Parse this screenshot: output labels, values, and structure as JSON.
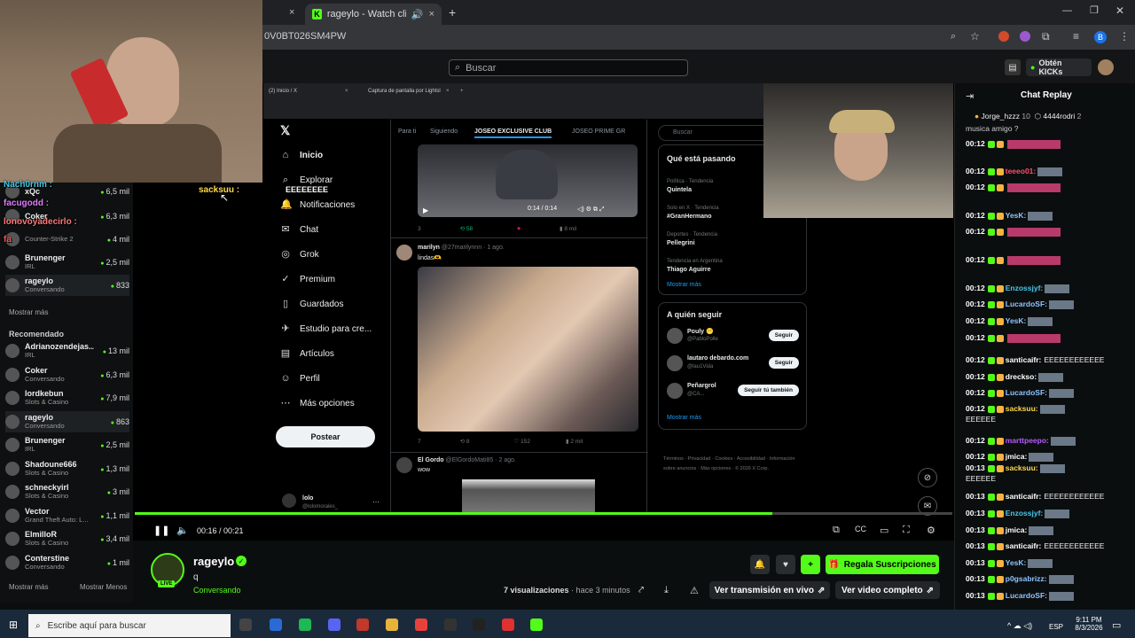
{
  "browser": {
    "tab1_close": "×",
    "active_tab_title": "rageylo - Watch clips on Ki",
    "url_fragment": "0V0BT026SM4PW",
    "profile_letter": "B"
  },
  "kick": {
    "search_placeholder": "Buscar",
    "get_kicks": "Obtén KICKs"
  },
  "sidebar": {
    "top_items": [
      {
        "name": "xQc",
        "sub": "",
        "viewers": "6,5 mil"
      },
      {
        "name": "Coker",
        "sub": "",
        "viewers": "6,3 mil"
      },
      {
        "name": "",
        "sub": "Counter-Strike 2",
        "viewers": "4 mil"
      },
      {
        "name": "Brunenger",
        "sub": "IRL",
        "viewers": "2,5 mil"
      },
      {
        "name": "rageylo",
        "sub": "Conversando",
        "viewers": "833"
      }
    ],
    "show_more": "Mostrar más",
    "recommended_heading": "Recomendado",
    "recommended": [
      {
        "name": "Adrianozendejas...",
        "sub": "IRL",
        "viewers": "13 mil"
      },
      {
        "name": "Coker",
        "sub": "Conversando",
        "viewers": "6,3 mil"
      },
      {
        "name": "lordkebun",
        "sub": "Slots & Casino",
        "viewers": "7,9 mil"
      },
      {
        "name": "rageylo",
        "sub": "Conversando",
        "viewers": "863"
      },
      {
        "name": "Brunenger",
        "sub": "IRL",
        "viewers": "2,5 mil"
      },
      {
        "name": "Shadoune666",
        "sub": "Slots & Casino",
        "viewers": "1,3 mil"
      },
      {
        "name": "schneckyirl",
        "sub": "Slots & Casino",
        "viewers": "3 mil"
      },
      {
        "name": "Vector",
        "sub": "Grand Theft Auto: L...",
        "viewers": "1,1 mil"
      },
      {
        "name": "ElmilloR",
        "sub": "Slots & Casino",
        "viewers": "3,4 mil"
      },
      {
        "name": "Conterstine",
        "sub": "Conversando",
        "viewers": "1 mil"
      }
    ],
    "show_more2": "Mostrar más",
    "show_less": "Mostrar Menos"
  },
  "overlay_names": {
    "n1": "Nach0rnm :",
    "n2": "facugodd :",
    "n3": "lonovoyadecirlo :",
    "n4": "fa",
    "n5": "sacksuu :",
    "n5_msg": "EEEEEEEE"
  },
  "xpage": {
    "tab1": "(2) Inicio / X",
    "tab2": "Captura de pantalla por Lightsl",
    "nav": [
      "Inicio",
      "Explorar",
      "Notificaciones",
      "Chat",
      "Grok",
      "Premium",
      "Guardados",
      "Estudio para cre...",
      "Artículos",
      "Perfil",
      "Más opciones"
    ],
    "post_button": "Postear",
    "account_name": "lolo",
    "account_handle": "@lolomorales_",
    "feed_tabs": [
      "Para ti",
      "Siguiendo",
      "JOSEO EXCLUSIVE CLUB",
      "JOSEO PRIME GR"
    ],
    "video_time": "0:14 / 0:14",
    "post1_name": "marilyn",
    "post1_handle": "@27marilynnn · 1 ago.",
    "post1_text": "lindas🫶",
    "post2_name": "El Gordo",
    "post2_handle": "@ElGordoMati85 · 2 ago.",
    "post2_text": "wow",
    "post1_stats": [
      "7",
      "8",
      "152",
      "2 mil"
    ],
    "top_stats": [
      "3",
      "58",
      "8 mil"
    ],
    "search_placeholder": "Buscar",
    "trending_title": "Qué está pasando",
    "trends": [
      {
        "ctx": "Política · Tendencia",
        "name": "Quintela"
      },
      {
        "ctx": "Solo en X · Tendencia",
        "name": "#GranHermano"
      },
      {
        "ctx": "Deportes · Tendencia",
        "name": "Pellegrini"
      },
      {
        "ctx": "Tendencia en Argentina",
        "name": "Thiago Aguirre"
      }
    ],
    "show_more": "Mostrar más",
    "who_to_follow": "A quién seguir",
    "follow_accounts": [
      {
        "name": "Pouly 😶",
        "handle": "@PabloPolle",
        "btn": "Seguir"
      },
      {
        "name": "lautaro debardo.com",
        "handle": "@lau1Vida",
        "btn": "Seguir"
      },
      {
        "name": "Peñargrol",
        "handle": "@CA...",
        "btn": "Seguir tú también"
      }
    ],
    "show_more2": "Mostrar más",
    "footer": "Términos · Privacidad · Cookies · Accesibilidad · Información sobre anuncios · Más opciones · © 2026 X Corp."
  },
  "player": {
    "time": "00:16 / 00:21",
    "progress_fraction": 0.78
  },
  "stream": {
    "channel": "rageylo",
    "title": "q",
    "category": "Conversando",
    "views": "7 visualizaciones",
    "ago": "· hace 3 minutos",
    "sub_button": "Regala Suscripciones",
    "watch_live": "Ver transmisión en vivo",
    "full_video": "Ver video completo",
    "live_badge": "LIVE"
  },
  "chat": {
    "title": "Chat Replay",
    "top_users": [
      {
        "name": "Jorge_hzzz",
        "count": "10"
      },
      {
        "name": "4444rodri",
        "count": "2"
      }
    ],
    "first_line": "musica amigo ?",
    "messages": [
      {
        "t": "00:12",
        "user": "",
        "color": "#e91916",
        "msg": ""
      },
      {
        "t": "00:12",
        "user": "teeeo01:",
        "color": "#ff4d6d",
        "msg": ""
      },
      {
        "t": "00:12",
        "user": "",
        "color": "#e91916",
        "msg": ""
      },
      {
        "t": "00:12",
        "user": "YesK:",
        "color": "#8ec5ff",
        "msg": ""
      },
      {
        "t": "00:12",
        "user": "",
        "color": "#e91916",
        "msg": ""
      },
      {
        "t": "00:12",
        "user": "",
        "color": "#e91916",
        "msg": ""
      },
      {
        "t": "00:12",
        "user": "Enzossjyf:",
        "color": "#47c8e8",
        "msg": ""
      },
      {
        "t": "00:12",
        "user": "LucardoSF:",
        "color": "#8ec5ff",
        "msg": ""
      },
      {
        "t": "00:12",
        "user": "YesK:",
        "color": "#8ec5ff",
        "msg": ""
      },
      {
        "t": "00:12",
        "user": "",
        "color": "#e91916",
        "msg": ""
      },
      {
        "t": "00:12",
        "user": "santicaifr:",
        "color": "#ffffff",
        "msg": "EEEEEEEEEEEE"
      },
      {
        "t": "00:12",
        "user": "dreckso:",
        "color": "#ffffff",
        "msg": ""
      },
      {
        "t": "00:12",
        "user": "LucardoSF:",
        "color": "#8ec5ff",
        "msg": ""
      },
      {
        "t": "00:12",
        "user": "sacksuu:",
        "color": "#ffd84a",
        "msg": ""
      },
      {
        "t": "",
        "user": "",
        "color": "",
        "msg": "EEEEEE"
      },
      {
        "t": "00:12",
        "user": "marttpeepo:",
        "color": "#b55cff",
        "msg": ""
      },
      {
        "t": "00:12",
        "user": "jmica:",
        "color": "#ffffff",
        "msg": ""
      },
      {
        "t": "00:13",
        "user": "sacksuu:",
        "color": "#ffd84a",
        "msg": ""
      },
      {
        "t": "",
        "user": "",
        "color": "",
        "msg": "EEEEEE"
      },
      {
        "t": "00:13",
        "user": "santicaifr:",
        "color": "#ffffff",
        "msg": "EEEEEEEEEEEE"
      },
      {
        "t": "00:13",
        "user": "Enzossjyf:",
        "color": "#47c8e8",
        "msg": ""
      },
      {
        "t": "00:13",
        "user": "jmica:",
        "color": "#ffffff",
        "msg": ""
      },
      {
        "t": "00:13",
        "user": "santicaifr:",
        "color": "#ffffff",
        "msg": "EEEEEEEEEEEE"
      },
      {
        "t": "00:13",
        "user": "YesK:",
        "color": "#8ec5ff",
        "msg": ""
      },
      {
        "t": "00:13",
        "user": "p0gsabrizz:",
        "color": "#8ec5ff",
        "msg": ""
      },
      {
        "t": "00:13",
        "user": "LucardoSF:",
        "color": "#8ec5ff",
        "msg": ""
      }
    ]
  },
  "taskbar": {
    "search_placeholder": "Escribe aquí para buscar",
    "lang": "ESP",
    "time": "9:11 PM",
    "date": "8/3/2026"
  },
  "colors": {
    "kick_green": "#53fc18",
    "chat_bg": "#0b0e0f"
  }
}
